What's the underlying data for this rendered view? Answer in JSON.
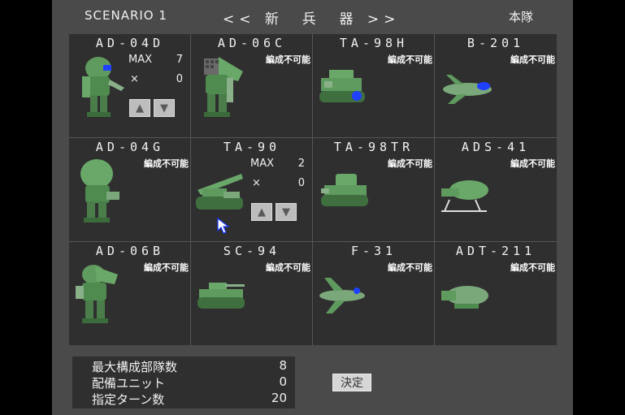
{
  "header": {
    "scenario": "SCENARIO 1",
    "title": "<< 新  兵  器 >>",
    "right_label": "本隊"
  },
  "units": [
    {
      "name": "AD-04D",
      "status": "",
      "max_label": "MAX",
      "max_value": "7",
      "count_label": "×",
      "count_value": "0",
      "up_icon": "up-triangle-icon",
      "down_icon": "down-triangle-icon"
    },
    {
      "name": "AD-06C",
      "status": "編成不可能"
    },
    {
      "name": "TA-98H",
      "status": "編成不可能"
    },
    {
      "name": "B-201",
      "status": "編成不可能"
    },
    {
      "name": "AD-04G",
      "status": "編成不可能"
    },
    {
      "name": "TA-90",
      "status": "",
      "max_label": "MAX",
      "max_value": "2",
      "count_label": "×",
      "count_value": "0",
      "up_icon": "up-triangle-icon",
      "down_icon": "down-triangle-icon"
    },
    {
      "name": "TA-98TR",
      "status": "編成不可能"
    },
    {
      "name": "ADS-41",
      "status": "編成不可能"
    },
    {
      "name": "AD-06B",
      "status": "編成不可能"
    },
    {
      "name": "SC-94",
      "status": "編成不可能"
    },
    {
      "name": "F-31",
      "status": "編成不可能"
    },
    {
      "name": "ADT-211",
      "status": "編成不可能"
    }
  ],
  "status_panel": {
    "rows": [
      {
        "label": "最大構成部隊数",
        "value": "8"
      },
      {
        "label": "配備ユニット",
        "value": "0"
      },
      {
        "label": "指定ターン数",
        "value": "20"
      }
    ]
  },
  "confirm_button": "決定",
  "colors": {
    "frame": "#4a4a4a",
    "panel": "#2f2f2f",
    "unit_green": "#5f9a5f",
    "accent_blue": "#2040ff"
  }
}
